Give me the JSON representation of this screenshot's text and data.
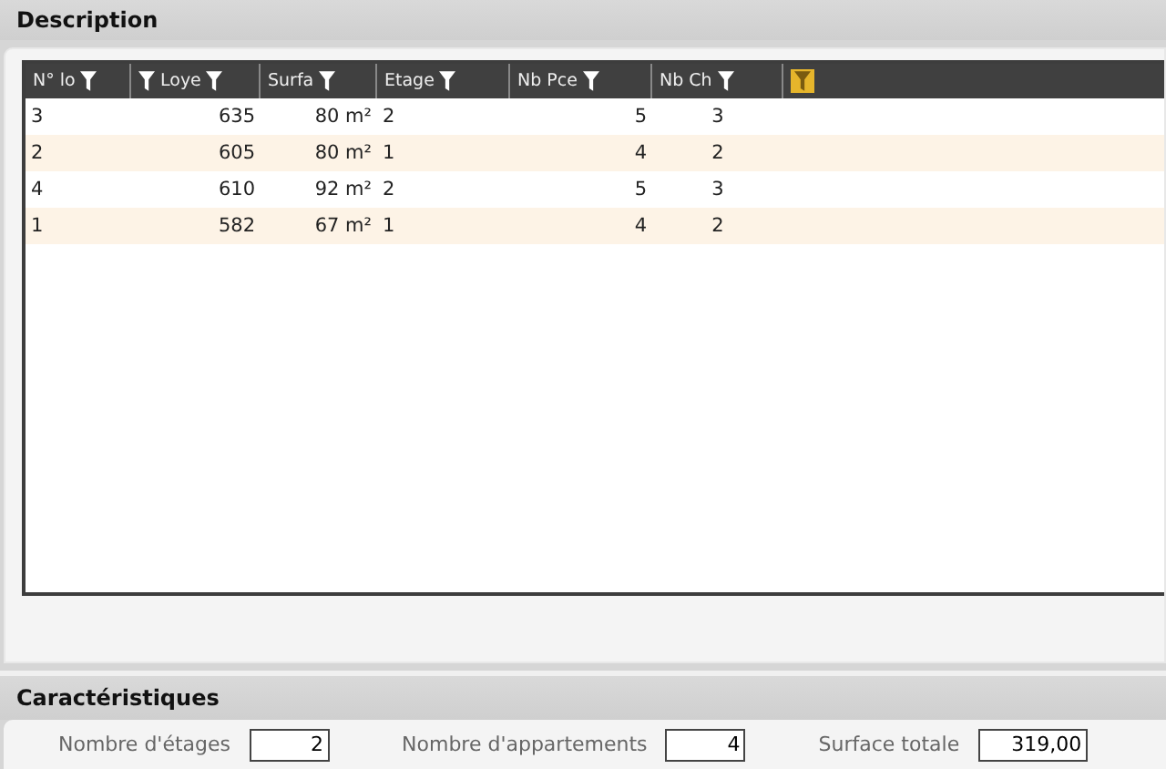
{
  "description": {
    "title": "Description",
    "columns": [
      {
        "label": "N° lo",
        "filter_active": false
      },
      {
        "label": "Loye",
        "filter_active": false,
        "leading_filter": true
      },
      {
        "label": "Surfa",
        "filter_active": false
      },
      {
        "label": "Etage",
        "filter_active": false
      },
      {
        "label": "Nb Pce",
        "filter_active": false
      },
      {
        "label": "Nb Ch",
        "filter_active": false
      },
      {
        "filter_active": true
      }
    ],
    "rows": [
      [
        "3",
        "635",
        "80 m²",
        "2",
        "5",
        "3"
      ],
      [
        "2",
        "605",
        "80 m²",
        "1",
        "4",
        "2"
      ],
      [
        "4",
        "610",
        "92 m²",
        "2",
        "5",
        "3"
      ],
      [
        "1",
        "582",
        "67 m²",
        "1",
        "4",
        "2"
      ]
    ]
  },
  "characteristics": {
    "title": "Caractéristiques",
    "fields": [
      {
        "label": "Nombre d'étages",
        "value": "2"
      },
      {
        "label": "Nombre d'appartements",
        "value": "4"
      },
      {
        "label": "Surface totale",
        "value": "319,00"
      }
    ]
  }
}
